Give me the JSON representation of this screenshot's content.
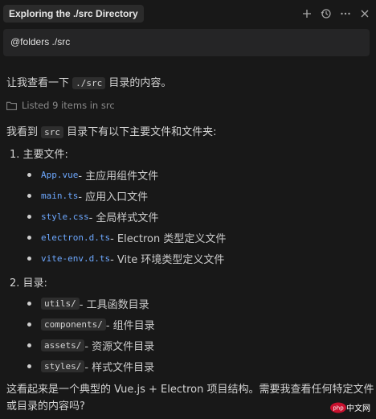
{
  "header": {
    "title": "Exploring the ./src Directory",
    "icons": [
      "plus-icon",
      "history-icon",
      "more-icon",
      "close-icon"
    ]
  },
  "query": {
    "text": "@folders ./src"
  },
  "intro": {
    "pre": "让我查看一下 ",
    "code": "./src",
    "post": " 目录的内容。"
  },
  "tool": {
    "icon": "folder-icon",
    "text": "Listed 9 items in src"
  },
  "summary": {
    "pre": "我看到 ",
    "code": "src",
    "post": " 目录下有以下主要文件和文件夹:"
  },
  "section1": {
    "title": "1. 主要文件:"
  },
  "files": [
    {
      "name": "App.vue",
      "desc": " - 主应用组件文件"
    },
    {
      "name": "main.ts",
      "desc": " - 应用入口文件"
    },
    {
      "name": "style.css",
      "desc": " - 全局样式文件"
    },
    {
      "name": "electron.d.ts",
      "desc": " - Electron 类型定义文件"
    },
    {
      "name": "vite-env.d.ts",
      "desc": " - Vite 环境类型定义文件"
    }
  ],
  "section2": {
    "title": "2. 目录:"
  },
  "dirs": [
    {
      "name": "utils/",
      "desc": " - 工具函数目录"
    },
    {
      "name": "components/",
      "desc": " - 组件目录"
    },
    {
      "name": "assets/",
      "desc": " - 资源文件目录"
    },
    {
      "name": "styles/",
      "desc": " - 样式文件目录"
    }
  ],
  "closing": {
    "line1": "这看起来是一个典型的 Vue.js + Electron 项目结构。需要我查看任何特定文件",
    "line2": "或目录的内容吗?"
  },
  "watermark": {
    "text": "php 中文网",
    "color": "#c8102e"
  }
}
